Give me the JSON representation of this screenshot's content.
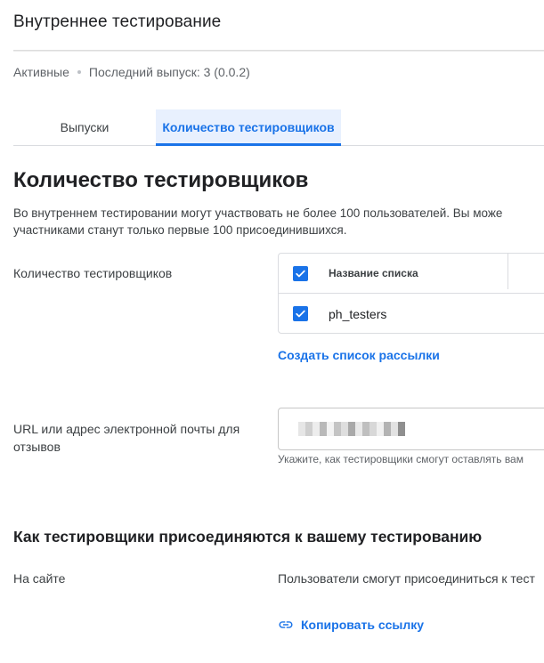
{
  "header": {
    "title": "Внутреннее тестирование"
  },
  "status": {
    "state": "Активные",
    "last_release": "Последний выпуск: 3 (0.0.2)"
  },
  "tabs": [
    {
      "label": "Выпуски",
      "active": false
    },
    {
      "label": "Количество тестировщиков",
      "active": true
    }
  ],
  "section": {
    "title": "Количество тестировщиков",
    "description_line1": "Во внутреннем тестировании могут участвовать не более 100 пользователей. Вы може",
    "description_line2": "участниками станут только первые 100 присоединившихся."
  },
  "testers": {
    "label": "Количество тестировщиков",
    "table": {
      "header": "Название списка",
      "rows": [
        {
          "name": "ph_testers",
          "checked": true
        }
      ]
    },
    "create_list_link": "Создать список рассылки"
  },
  "feedback": {
    "label_line1": "URL или адрес электронной почты для",
    "label_line2": "отзывов",
    "hint": "Укажите, как тестировщики смогут оставлять вам"
  },
  "join": {
    "title": "Как тестировщики присоединяются к вашему тестированию",
    "site_label": "На сайте",
    "site_text": "Пользователи смогут присоединиться к тест",
    "copy_link": "Копировать ссылку"
  },
  "colors": {
    "accent": "#1a73e8",
    "tab_active_bg": "#e8f0fe",
    "border": "#dadce0"
  }
}
